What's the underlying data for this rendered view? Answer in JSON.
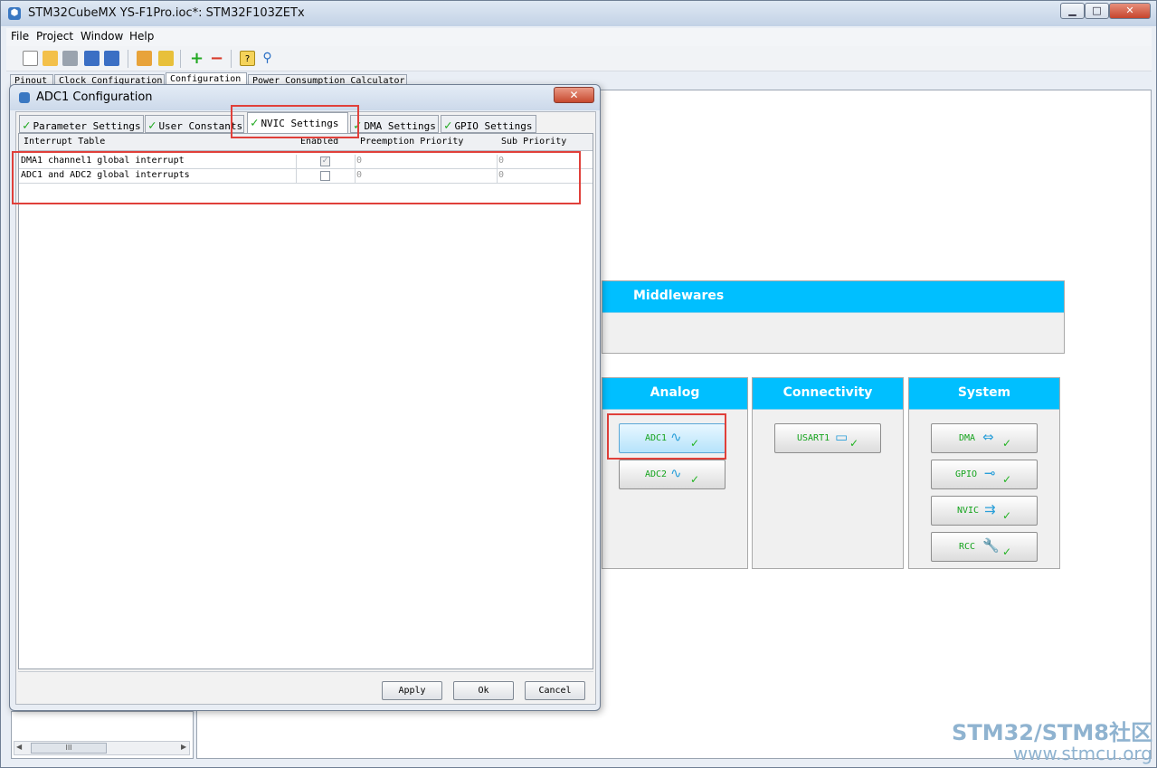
{
  "window": {
    "title": "STM32CubeMX YS-F1Pro.ioc*: STM32F103ZETx",
    "minimize": "▁",
    "maximize": "□",
    "close": "✕"
  },
  "menu": [
    "File",
    "Project",
    "Window",
    "Help"
  ],
  "main_tabs": [
    "Pinout",
    "Clock Configuration",
    "Configuration",
    "Power Consumption Calculator"
  ],
  "categories": {
    "middlewares": "Middlewares",
    "analog": "Analog",
    "connectivity": "Connectivity",
    "system": "System"
  },
  "peripherals": {
    "analog": [
      "ADC1",
      "ADC2"
    ],
    "connectivity": [
      "USART1"
    ],
    "system": [
      "DMA",
      "GPIO",
      "NVIC",
      "RCC"
    ]
  },
  "dialog": {
    "title": "ADC1 Configuration",
    "close": "✕",
    "tabs": [
      "Parameter Settings",
      "User Constants",
      "NVIC Settings",
      "DMA Settings",
      "GPIO Settings"
    ],
    "active_tab": "NVIC Settings",
    "table": {
      "headers": [
        "Interrupt Table",
        "Enabled",
        "Preemption Priority",
        "Sub Priority"
      ],
      "rows": [
        {
          "name": "DMA1 channel1 global interrupt",
          "enabled": true,
          "preemption": "0",
          "sub": "0"
        },
        {
          "name": "ADC1 and ADC2 global interrupts",
          "enabled": false,
          "preemption": "0",
          "sub": "0"
        }
      ]
    },
    "buttons": {
      "apply": "Apply",
      "ok": "Ok",
      "cancel": "Cancel"
    }
  },
  "scrollbar": {
    "thumb": "III"
  },
  "watermark": {
    "line1": "STM32/STM8社区",
    "line2": "www.stmcu.org"
  },
  "colors": {
    "category_header": "#00bfff",
    "highlight": "#e0403a",
    "check": "#1fa81f"
  }
}
